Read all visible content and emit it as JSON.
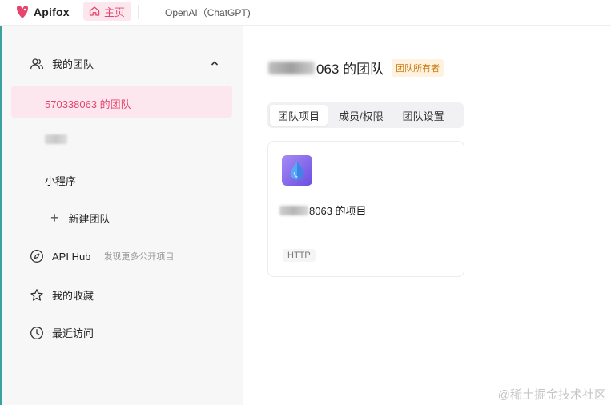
{
  "topbar": {
    "logo_text": "Apifox",
    "home_tab_label": "主页",
    "project_tab_label": "OpenAI（ChatGPT)"
  },
  "sidebar": {
    "team_header_label": "我的团队",
    "teams": [
      {
        "label": "570338063 的团队",
        "selected": true
      },
      {
        "label": "",
        "blurred": true
      },
      {
        "label": "小程序"
      }
    ],
    "new_team_label": "新建团队",
    "api_hub_label": "API Hub",
    "api_hub_sub": "发现更多公开项目",
    "favorites_label": "我的收藏",
    "recent_label": "最近访问"
  },
  "main": {
    "team_title_visible": "063 的团队",
    "owner_badge": "团队所有者",
    "tabs": [
      {
        "label": "团队项目",
        "active": true
      },
      {
        "label": "成员/权限"
      },
      {
        "label": "团队设置"
      }
    ],
    "project": {
      "name_visible": "8063 的项目",
      "type_tag": "HTTP"
    }
  },
  "watermark": "@稀土掘金技术社区",
  "colors": {
    "accent": "#e6456f",
    "accent_bg": "#fde7ee",
    "owner_badge_text": "#c97b13",
    "project_icon": "#7b5cf0"
  },
  "icons": [
    "apifox-logo-icon",
    "home-icon",
    "team-icon",
    "chevron-up-icon",
    "plus-icon",
    "compass-icon",
    "star-icon",
    "clock-icon",
    "water-drop-icon"
  ]
}
